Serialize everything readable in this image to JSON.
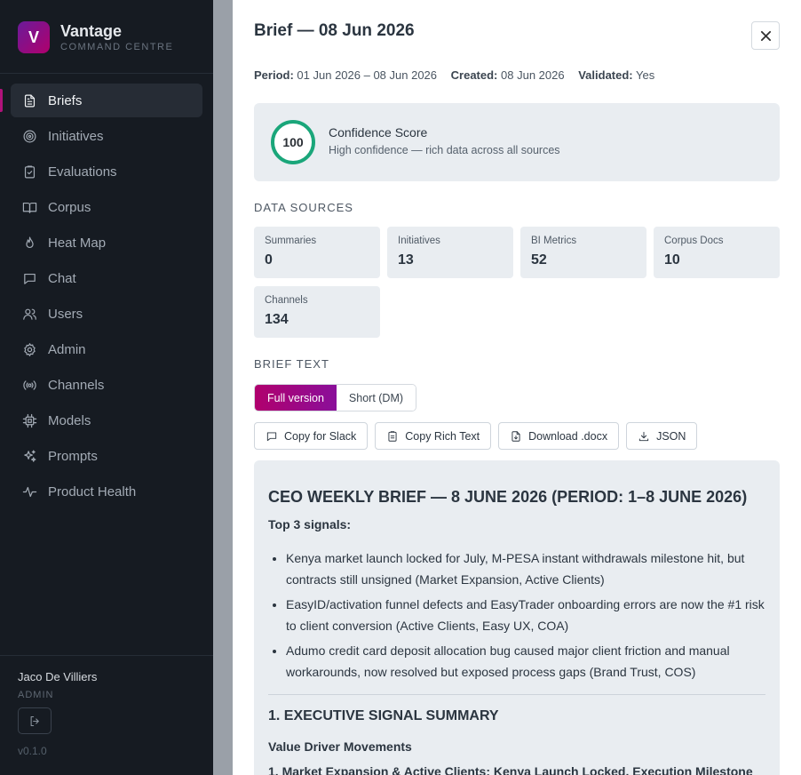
{
  "sidebar": {
    "brand": {
      "logo_letter": "V",
      "name": "Vantage",
      "subtitle": "COMMAND CENTRE"
    },
    "items": [
      {
        "label": "Briefs",
        "icon": "document-icon",
        "active": true
      },
      {
        "label": "Initiatives",
        "icon": "target-icon"
      },
      {
        "label": "Evaluations",
        "icon": "clipboard-check-icon"
      },
      {
        "label": "Corpus",
        "icon": "book-open-icon"
      },
      {
        "label": "Heat Map",
        "icon": "flame-icon"
      },
      {
        "label": "Chat",
        "icon": "chat-bubble-icon"
      },
      {
        "label": "Users",
        "icon": "users-icon"
      },
      {
        "label": "Admin",
        "icon": "gear-icon"
      },
      {
        "label": "Channels",
        "icon": "radio-signal-icon"
      },
      {
        "label": "Models",
        "icon": "cpu-chip-icon"
      },
      {
        "label": "Prompts",
        "icon": "sparkles-icon"
      },
      {
        "label": "Product Health",
        "icon": "pulse-icon"
      }
    ],
    "user": {
      "name": "Jaco De Villiers",
      "role": "ADMIN"
    },
    "version": "v0.1.0"
  },
  "panel": {
    "title": "Brief — 08 Jun 2026",
    "meta": {
      "period_label": "Period:",
      "period_value": "01 Jun 2026 – 08 Jun 2026",
      "created_label": "Created:",
      "created_value": "08 Jun 2026",
      "validated_label": "Validated:",
      "validated_value": "Yes"
    },
    "confidence": {
      "score": "100",
      "title": "Confidence Score",
      "subtitle": "High confidence — rich data across all sources",
      "ring_color": "#1aa67a"
    },
    "data_sources": {
      "label": "DATA SOURCES",
      "items": [
        {
          "label": "Summaries",
          "value": "0"
        },
        {
          "label": "Initiatives",
          "value": "13"
        },
        {
          "label": "BI Metrics",
          "value": "52"
        },
        {
          "label": "Corpus Docs",
          "value": "10"
        },
        {
          "label": "Channels",
          "value": "134"
        }
      ]
    },
    "brief_text": {
      "label": "BRIEF TEXT",
      "toggle": {
        "full": "Full version",
        "short": "Short (DM)"
      },
      "actions": {
        "copy_slack": "Copy for Slack",
        "copy_rich": "Copy Rich Text",
        "download_docx": "Download .docx",
        "json": "JSON"
      }
    },
    "brief": {
      "heading": "CEO WEEKLY BRIEF — 8 JUNE 2026 (PERIOD: 1–8 JUNE 2026)",
      "lead": "Top 3 signals:",
      "signals": [
        "Kenya market launch locked for July, M-PESA instant withdrawals milestone hit, but contracts still unsigned (Market Expansion, Active Clients)",
        "EasyID/activation funnel defects and EasyTrader onboarding errors are now the #1 risk to client conversion (Active Clients, Easy UX, COA)",
        "Adumo credit card deposit allocation bug caused major client friction and manual workarounds, now resolved but exposed process gaps (Brand Trust, COS)"
      ],
      "section_1": "1. EXECUTIVE SIGNAL SUMMARY",
      "subsection": "Value Driver Movements",
      "item_1": "1. Market Expansion & Active Clients: Kenya Launch Locked, Execution Milestone"
    },
    "accent": "#b0006d"
  }
}
